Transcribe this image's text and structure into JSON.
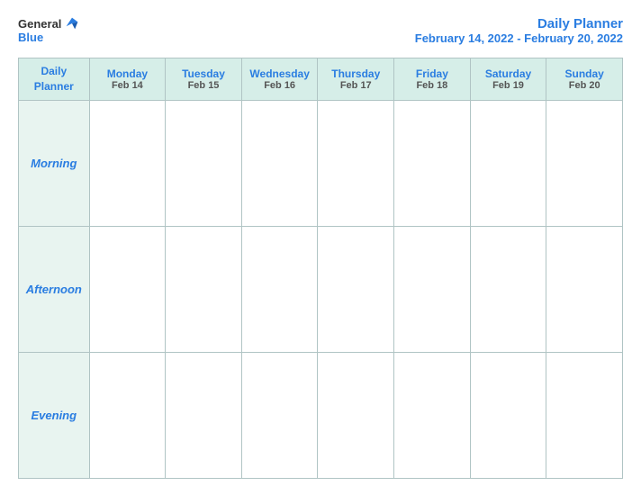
{
  "logo": {
    "general": "General",
    "blue": "Blue"
  },
  "title": {
    "line1": "Daily Planner",
    "line2": "February 14, 2022 - February 20, 2022"
  },
  "table": {
    "header": {
      "col0_line1": "Daily",
      "col0_line2": "Planner",
      "columns": [
        {
          "day": "Monday",
          "date": "Feb 14"
        },
        {
          "day": "Tuesday",
          "date": "Feb 15"
        },
        {
          "day": "Wednesday",
          "date": "Feb 16"
        },
        {
          "day": "Thursday",
          "date": "Feb 17"
        },
        {
          "day": "Friday",
          "date": "Feb 18"
        },
        {
          "day": "Saturday",
          "date": "Feb 19"
        },
        {
          "day": "Sunday",
          "date": "Feb 20"
        }
      ]
    },
    "rows": [
      {
        "label": "Morning"
      },
      {
        "label": "Afternoon"
      },
      {
        "label": "Evening"
      }
    ]
  }
}
